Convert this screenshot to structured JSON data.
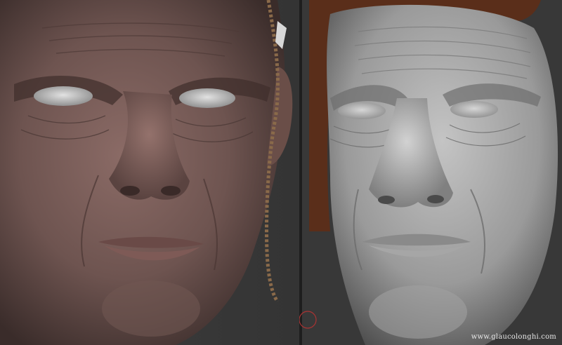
{
  "image": {
    "description_panels": [
      "textured-render",
      "clay-render"
    ],
    "watermark": "www.glaucolonghi.com"
  },
  "colors": {
    "skin_base": "#6e5450",
    "skin_shadow": "#3a2c2a",
    "clay_base": "#9a9a9a",
    "clay_shadow": "#4a4a4a",
    "hood_brown": "#5a2e1a",
    "rope": "#8a6a4a",
    "background": "#3b3b3b"
  }
}
